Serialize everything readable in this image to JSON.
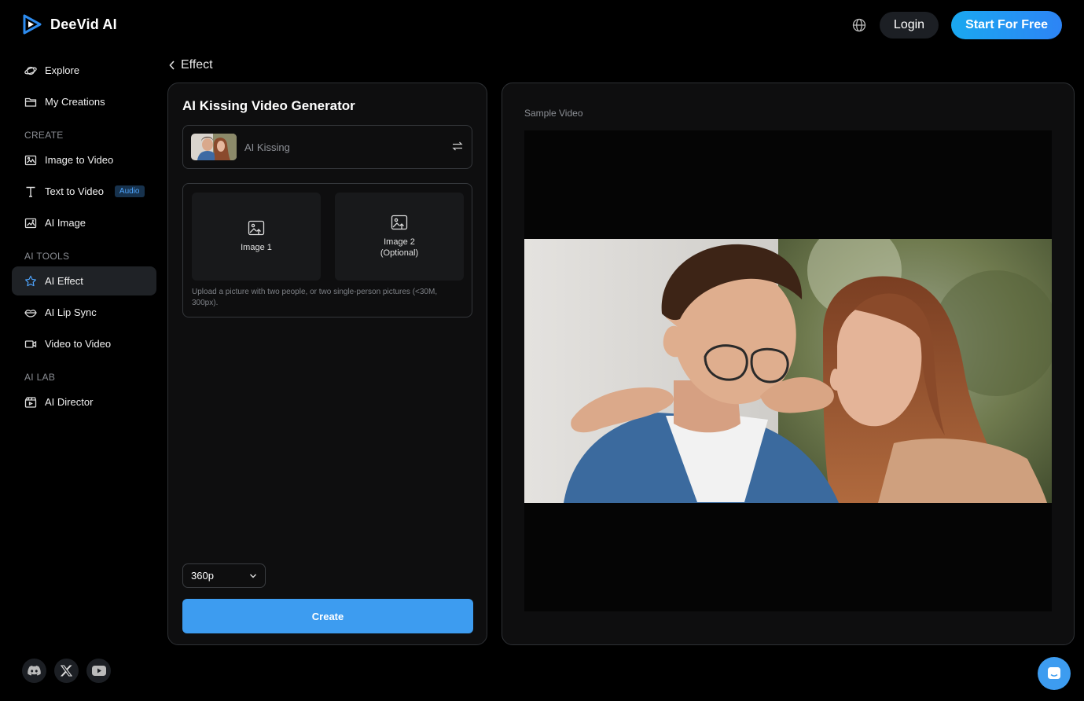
{
  "brand": {
    "name": "DeeVid AI",
    "accent": "#3d9cf0"
  },
  "header": {
    "login_label": "Login",
    "start_label": "Start For Free"
  },
  "sidebar": {
    "items": [
      {
        "label": "Explore",
        "icon": "planet-icon"
      },
      {
        "label": "My Creations",
        "icon": "folder-icon"
      }
    ],
    "create_label": "CREATE",
    "create_items": [
      {
        "label": "Image to Video",
        "icon": "image-icon"
      },
      {
        "label": "Text to Video",
        "icon": "text-icon",
        "badge": "Audio"
      },
      {
        "label": "AI Image",
        "icon": "ai-image-icon"
      }
    ],
    "tools_label": "AI TOOLS",
    "tools_items": [
      {
        "label": "AI Effect",
        "icon": "star-icon",
        "active": true
      },
      {
        "label": "AI Lip Sync",
        "icon": "lips-icon"
      },
      {
        "label": "Video to Video",
        "icon": "video-camera-icon"
      }
    ],
    "lab_label": "AI LAB",
    "lab_items": [
      {
        "label": "AI Director",
        "icon": "clapper-icon"
      }
    ]
  },
  "breadcrumb": {
    "label": "Effect"
  },
  "generator": {
    "title": "AI Kissing Video Generator",
    "effect_name": "AI Kissing",
    "slot1_label": "Image 1",
    "slot2_label": "Image 2\n(Optional)",
    "upload_hint": "Upload a picture with two people, or two single-person pictures (<30M, 300px).",
    "resolution": "360p",
    "create_label": "Create"
  },
  "preview": {
    "label": "Sample Video"
  }
}
